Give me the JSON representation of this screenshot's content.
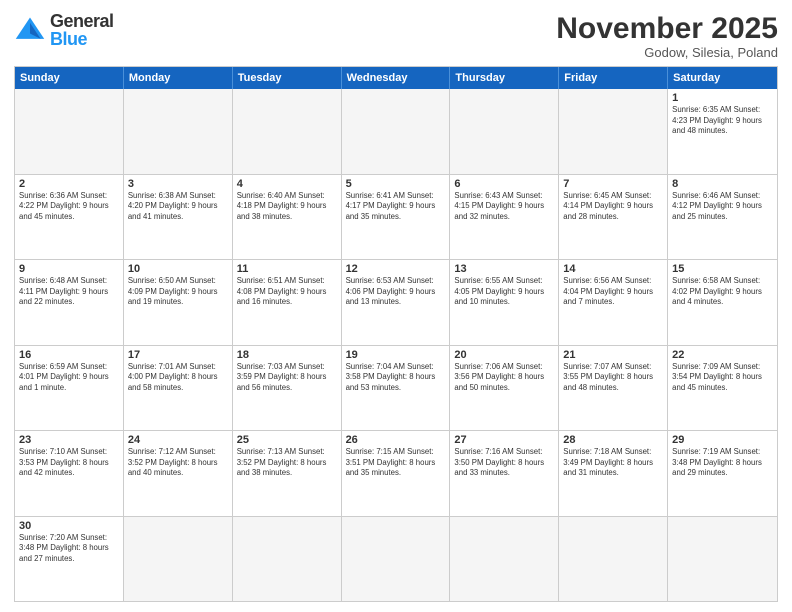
{
  "header": {
    "logo_general": "General",
    "logo_blue": "Blue",
    "month_title": "November 2025",
    "subtitle": "Godow, Silesia, Poland"
  },
  "days_of_week": [
    "Sunday",
    "Monday",
    "Tuesday",
    "Wednesday",
    "Thursday",
    "Friday",
    "Saturday"
  ],
  "weeks": [
    [
      {
        "day": "",
        "info": "",
        "empty": true
      },
      {
        "day": "",
        "info": "",
        "empty": true
      },
      {
        "day": "",
        "info": "",
        "empty": true
      },
      {
        "day": "",
        "info": "",
        "empty": true
      },
      {
        "day": "",
        "info": "",
        "empty": true
      },
      {
        "day": "",
        "info": "",
        "empty": true
      },
      {
        "day": "1",
        "info": "Sunrise: 6:35 AM\nSunset: 4:23 PM\nDaylight: 9 hours\nand 48 minutes.",
        "empty": false
      }
    ],
    [
      {
        "day": "2",
        "info": "Sunrise: 6:36 AM\nSunset: 4:22 PM\nDaylight: 9 hours\nand 45 minutes.",
        "empty": false
      },
      {
        "day": "3",
        "info": "Sunrise: 6:38 AM\nSunset: 4:20 PM\nDaylight: 9 hours\nand 41 minutes.",
        "empty": false
      },
      {
        "day": "4",
        "info": "Sunrise: 6:40 AM\nSunset: 4:18 PM\nDaylight: 9 hours\nand 38 minutes.",
        "empty": false
      },
      {
        "day": "5",
        "info": "Sunrise: 6:41 AM\nSunset: 4:17 PM\nDaylight: 9 hours\nand 35 minutes.",
        "empty": false
      },
      {
        "day": "6",
        "info": "Sunrise: 6:43 AM\nSunset: 4:15 PM\nDaylight: 9 hours\nand 32 minutes.",
        "empty": false
      },
      {
        "day": "7",
        "info": "Sunrise: 6:45 AM\nSunset: 4:14 PM\nDaylight: 9 hours\nand 28 minutes.",
        "empty": false
      },
      {
        "day": "8",
        "info": "Sunrise: 6:46 AM\nSunset: 4:12 PM\nDaylight: 9 hours\nand 25 minutes.",
        "empty": false
      }
    ],
    [
      {
        "day": "9",
        "info": "Sunrise: 6:48 AM\nSunset: 4:11 PM\nDaylight: 9 hours\nand 22 minutes.",
        "empty": false
      },
      {
        "day": "10",
        "info": "Sunrise: 6:50 AM\nSunset: 4:09 PM\nDaylight: 9 hours\nand 19 minutes.",
        "empty": false
      },
      {
        "day": "11",
        "info": "Sunrise: 6:51 AM\nSunset: 4:08 PM\nDaylight: 9 hours\nand 16 minutes.",
        "empty": false
      },
      {
        "day": "12",
        "info": "Sunrise: 6:53 AM\nSunset: 4:06 PM\nDaylight: 9 hours\nand 13 minutes.",
        "empty": false
      },
      {
        "day": "13",
        "info": "Sunrise: 6:55 AM\nSunset: 4:05 PM\nDaylight: 9 hours\nand 10 minutes.",
        "empty": false
      },
      {
        "day": "14",
        "info": "Sunrise: 6:56 AM\nSunset: 4:04 PM\nDaylight: 9 hours\nand 7 minutes.",
        "empty": false
      },
      {
        "day": "15",
        "info": "Sunrise: 6:58 AM\nSunset: 4:02 PM\nDaylight: 9 hours\nand 4 minutes.",
        "empty": false
      }
    ],
    [
      {
        "day": "16",
        "info": "Sunrise: 6:59 AM\nSunset: 4:01 PM\nDaylight: 9 hours\nand 1 minute.",
        "empty": false
      },
      {
        "day": "17",
        "info": "Sunrise: 7:01 AM\nSunset: 4:00 PM\nDaylight: 8 hours\nand 58 minutes.",
        "empty": false
      },
      {
        "day": "18",
        "info": "Sunrise: 7:03 AM\nSunset: 3:59 PM\nDaylight: 8 hours\nand 56 minutes.",
        "empty": false
      },
      {
        "day": "19",
        "info": "Sunrise: 7:04 AM\nSunset: 3:58 PM\nDaylight: 8 hours\nand 53 minutes.",
        "empty": false
      },
      {
        "day": "20",
        "info": "Sunrise: 7:06 AM\nSunset: 3:56 PM\nDaylight: 8 hours\nand 50 minutes.",
        "empty": false
      },
      {
        "day": "21",
        "info": "Sunrise: 7:07 AM\nSunset: 3:55 PM\nDaylight: 8 hours\nand 48 minutes.",
        "empty": false
      },
      {
        "day": "22",
        "info": "Sunrise: 7:09 AM\nSunset: 3:54 PM\nDaylight: 8 hours\nand 45 minutes.",
        "empty": false
      }
    ],
    [
      {
        "day": "23",
        "info": "Sunrise: 7:10 AM\nSunset: 3:53 PM\nDaylight: 8 hours\nand 42 minutes.",
        "empty": false
      },
      {
        "day": "24",
        "info": "Sunrise: 7:12 AM\nSunset: 3:52 PM\nDaylight: 8 hours\nand 40 minutes.",
        "empty": false
      },
      {
        "day": "25",
        "info": "Sunrise: 7:13 AM\nSunset: 3:52 PM\nDaylight: 8 hours\nand 38 minutes.",
        "empty": false
      },
      {
        "day": "26",
        "info": "Sunrise: 7:15 AM\nSunset: 3:51 PM\nDaylight: 8 hours\nand 35 minutes.",
        "empty": false
      },
      {
        "day": "27",
        "info": "Sunrise: 7:16 AM\nSunset: 3:50 PM\nDaylight: 8 hours\nand 33 minutes.",
        "empty": false
      },
      {
        "day": "28",
        "info": "Sunrise: 7:18 AM\nSunset: 3:49 PM\nDaylight: 8 hours\nand 31 minutes.",
        "empty": false
      },
      {
        "day": "29",
        "info": "Sunrise: 7:19 AM\nSunset: 3:48 PM\nDaylight: 8 hours\nand 29 minutes.",
        "empty": false
      }
    ],
    [
      {
        "day": "30",
        "info": "Sunrise: 7:20 AM\nSunset: 3:48 PM\nDaylight: 8 hours\nand 27 minutes.",
        "empty": false
      },
      {
        "day": "",
        "info": "",
        "empty": true
      },
      {
        "day": "",
        "info": "",
        "empty": true
      },
      {
        "day": "",
        "info": "",
        "empty": true
      },
      {
        "day": "",
        "info": "",
        "empty": true
      },
      {
        "day": "",
        "info": "",
        "empty": true
      },
      {
        "day": "",
        "info": "",
        "empty": true
      }
    ]
  ]
}
